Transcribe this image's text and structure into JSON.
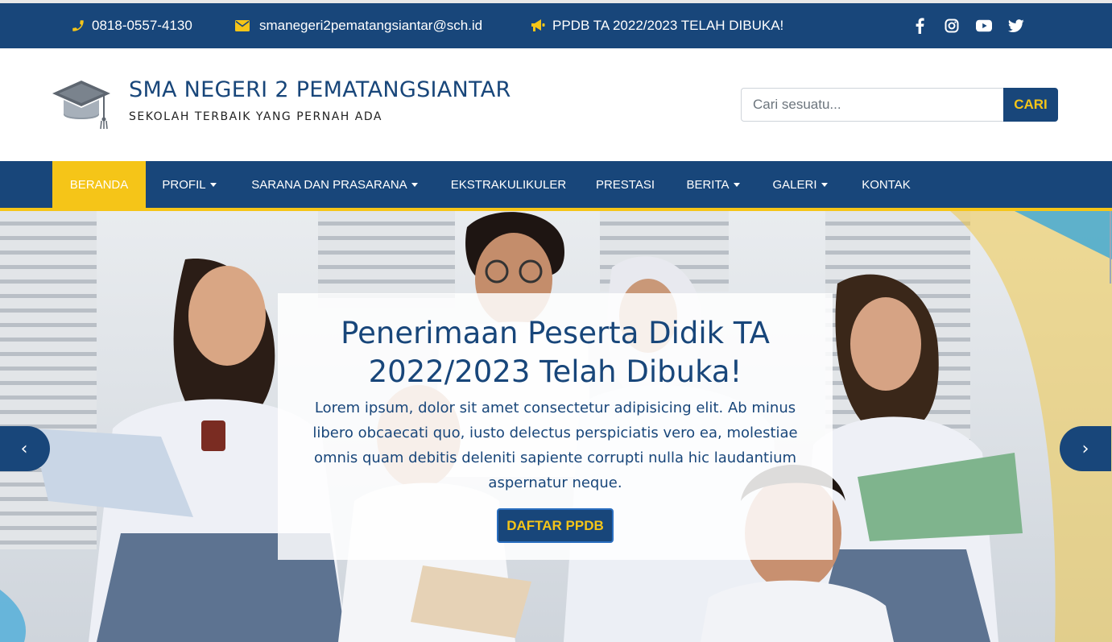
{
  "topbar": {
    "phone": "0818-0557-4130",
    "email": "smanegeri2pematangsiantar@sch.id",
    "announcement": "PPDB TA 2022/2023 TELAH DIBUKA!",
    "icons": [
      "phone-icon",
      "envelope-icon",
      "megaphone-icon"
    ],
    "socials": [
      "facebook-icon",
      "instagram-icon",
      "youtube-icon",
      "twitter-icon"
    ]
  },
  "header": {
    "school_name": "SMA NEGERI 2 PEMATANGSIANTAR",
    "tagline": "SEKOLAH TERBAIK YANG PERNAH ADA",
    "logo_icon": "graduation-cap-icon"
  },
  "search": {
    "placeholder": "Cari sesuatu...",
    "value": "",
    "button_label": "CARI"
  },
  "nav": {
    "items": [
      {
        "label": "BERANDA",
        "active": true,
        "dropdown": false
      },
      {
        "label": "PROFIL",
        "active": false,
        "dropdown": true
      },
      {
        "label": "SARANA DAN PRASARANA",
        "active": false,
        "dropdown": true
      },
      {
        "label": "EKSTRAKULIKULER",
        "active": false,
        "dropdown": false
      },
      {
        "label": "PRESTASI",
        "active": false,
        "dropdown": false
      },
      {
        "label": "BERITA",
        "active": false,
        "dropdown": true
      },
      {
        "label": "GALERI",
        "active": false,
        "dropdown": true
      },
      {
        "label": "KONTAK",
        "active": false,
        "dropdown": false
      }
    ]
  },
  "hero": {
    "title": "Penerimaan Peserta Didik TA 2022/2023 Telah Dibuka!",
    "text": "Lorem ipsum, dolor sit amet consectetur adipisicing elit. Ab minus libero obcaecati quo, iusto delectus perspiciatis vero ea, molestiae omnis quam debitis deleniti sapiente corrupti nulla hic laudantium aspernatur neque.",
    "cta_label": "DAFTAR PPDB",
    "prev_label": "‹",
    "next_label": "›"
  },
  "colors": {
    "primary": "#18467a",
    "accent": "#f5c518",
    "white": "#ffffff"
  }
}
